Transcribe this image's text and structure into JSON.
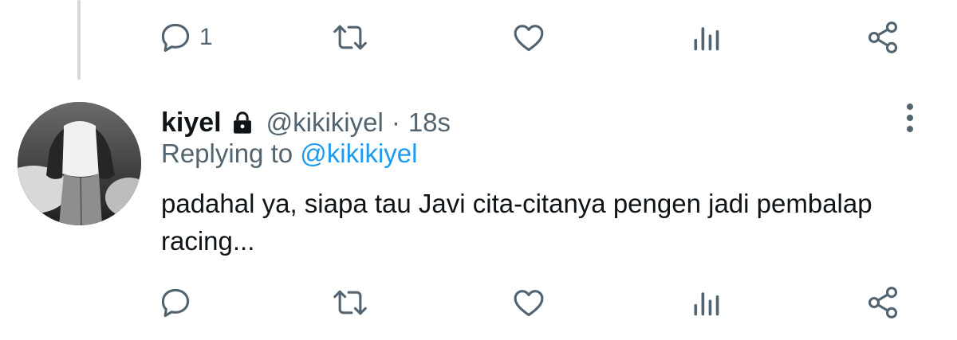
{
  "top_actions": {
    "reply_count": "1"
  },
  "tweet": {
    "display_name": "kiyel",
    "handle": "@kikikiyel",
    "separator": "·",
    "time": "18s",
    "replying_prefix": "Replying to",
    "replying_to": "@kikikiyel",
    "text": "padahal ya, siapa tau Javi cita-citanya pengen jadi pembalap racing..."
  },
  "icons": {
    "reply": "reply-icon",
    "retweet": "retweet-icon",
    "like": "heart-icon",
    "stats": "stats-icon",
    "share": "share-icon",
    "lock": "lock-icon",
    "more": "more-vertical-icon"
  },
  "colors": {
    "icon": "#536471",
    "text": "#0f1419",
    "mention": "#1d9bf0",
    "thread_line": "#cfd9de"
  }
}
